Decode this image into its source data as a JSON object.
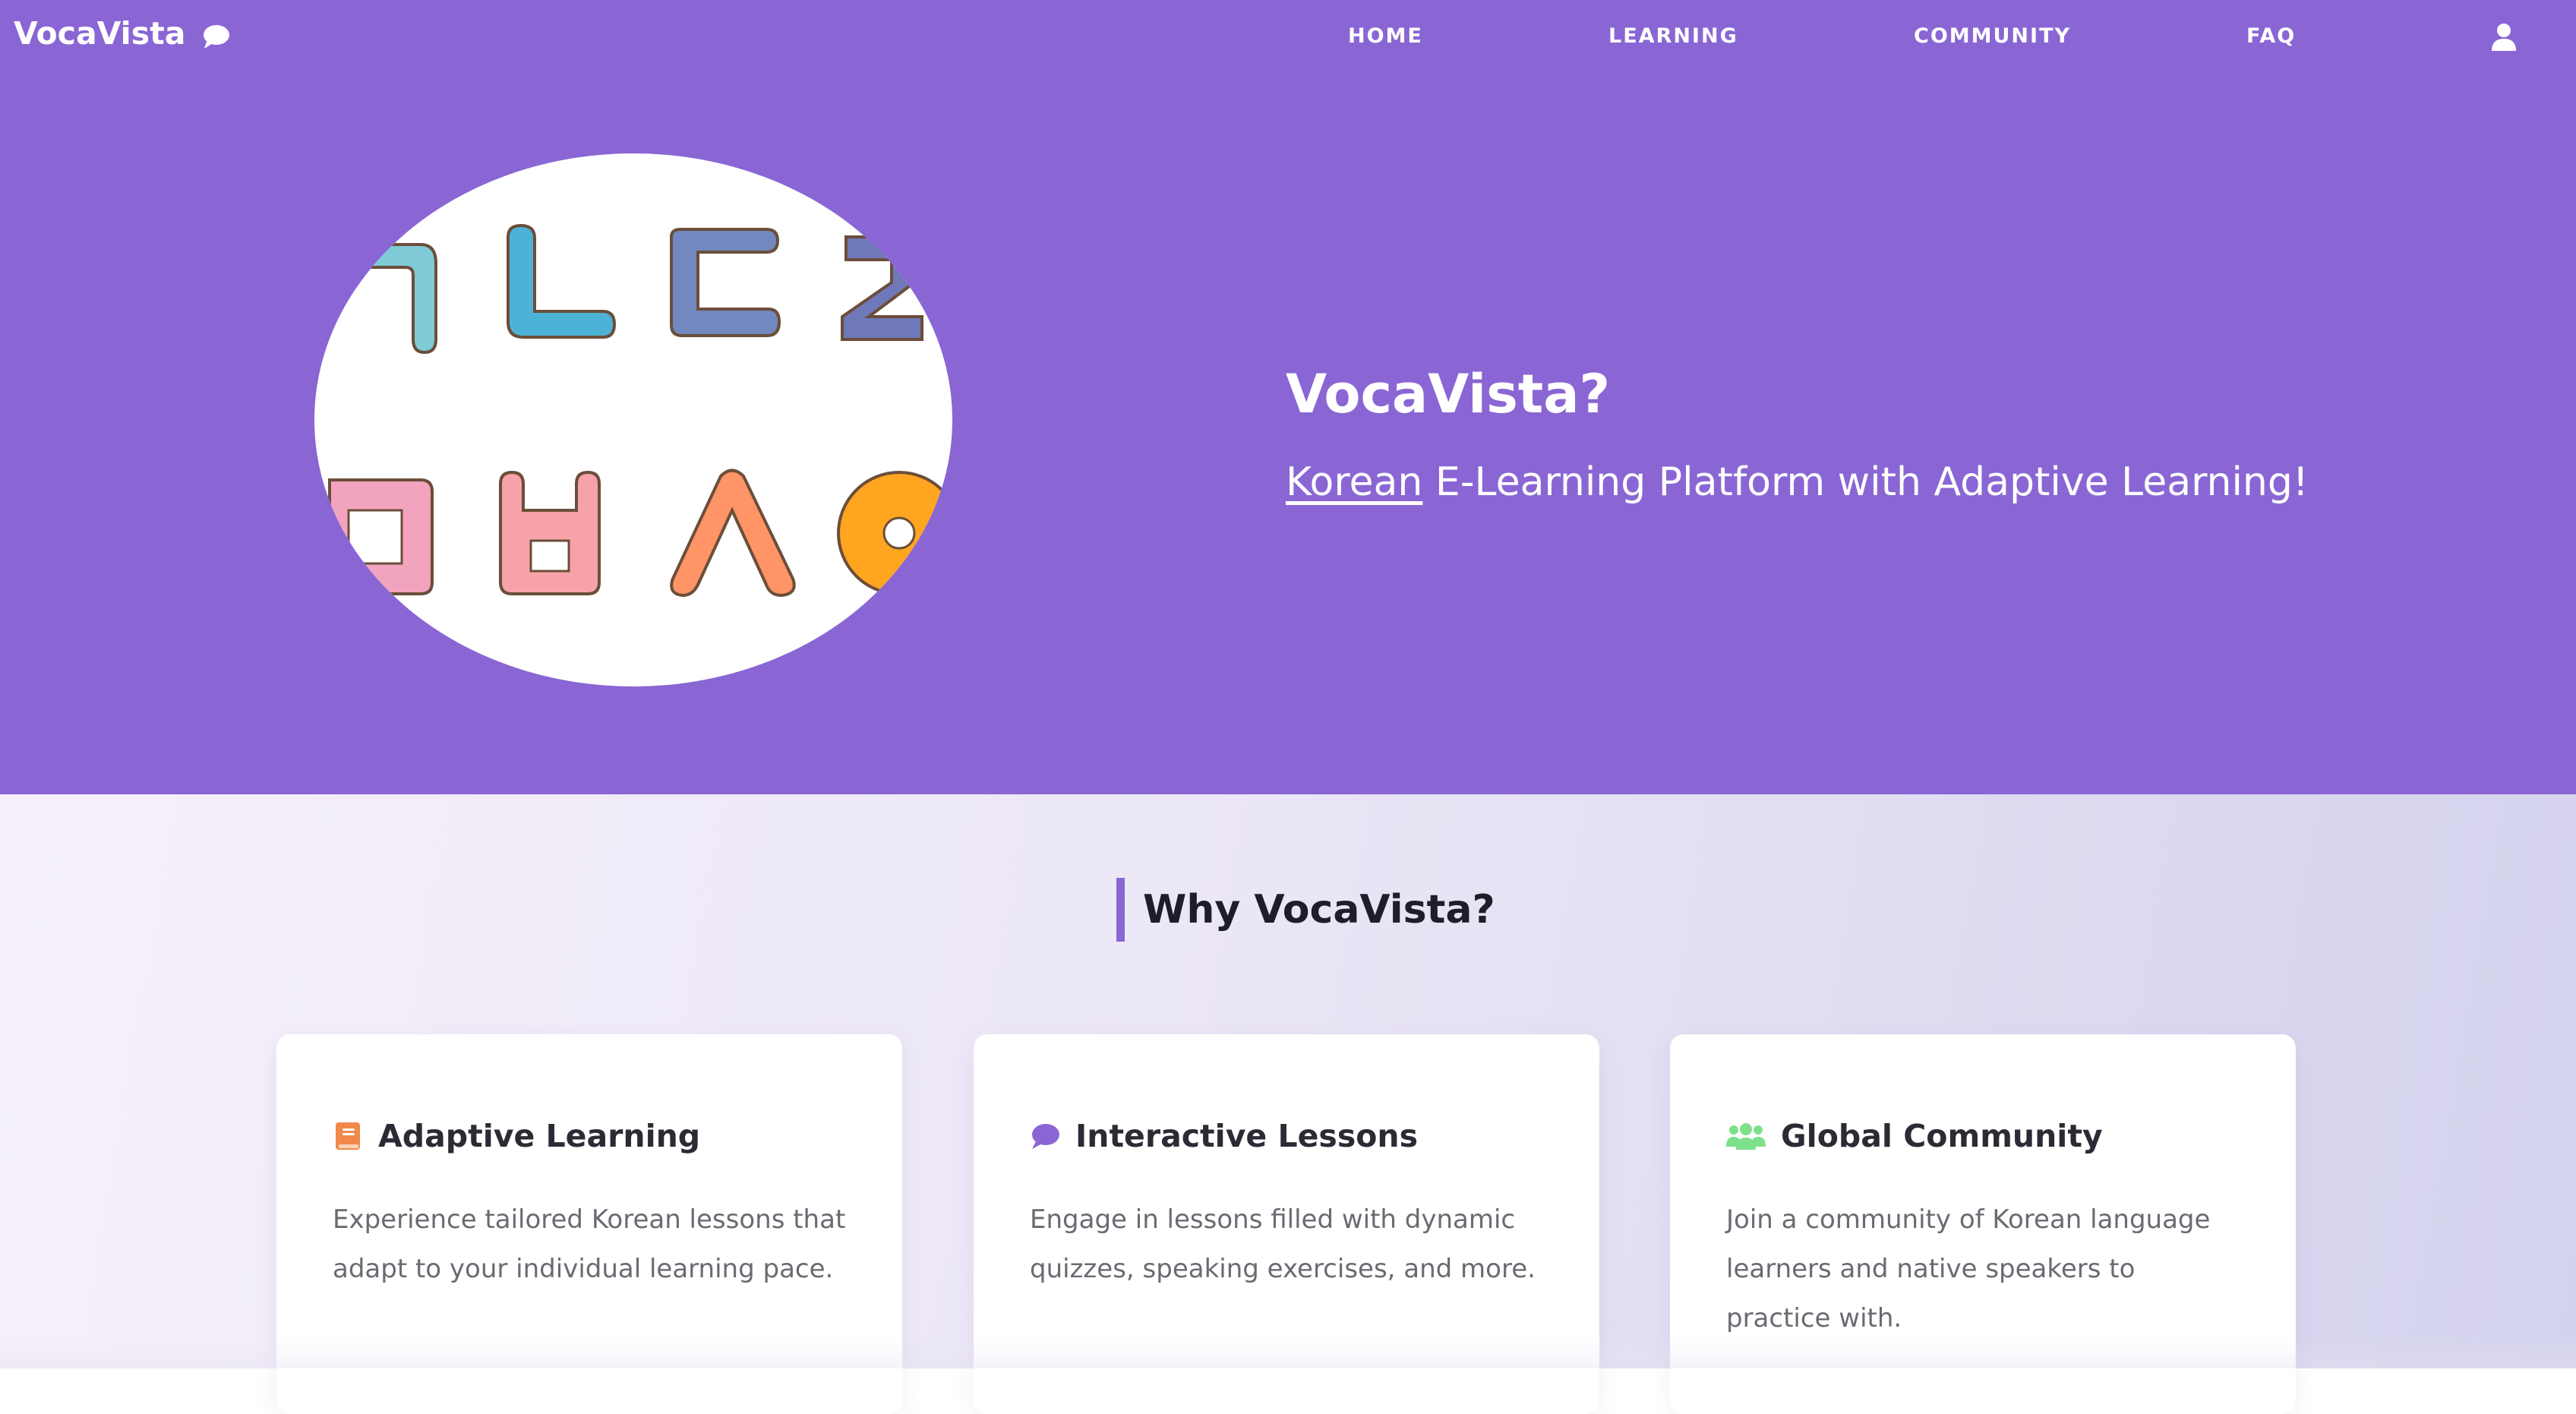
{
  "brand": {
    "name": "VocaVista",
    "icon": "chat-bubble-icon"
  },
  "nav": {
    "items": [
      {
        "label": "HOME"
      },
      {
        "label": "LEARNING"
      },
      {
        "label": "COMMUNITY"
      },
      {
        "label": "FAQ"
      }
    ],
    "user_icon": "user-icon"
  },
  "hero": {
    "title": "VocaVista?",
    "subtitle_highlight": "Korean",
    "subtitle_rest": " E-Learning Platform with Adaptive Learning!",
    "image_icon": "hangul-letters-image"
  },
  "features": {
    "title": "Why VocaVista?",
    "cards": [
      {
        "icon": "book-icon",
        "icon_color": "#f0894a",
        "title": "Adaptive Learning",
        "text": "Experience tailored Korean lessons that adapt to your individual learning pace."
      },
      {
        "icon": "chat-bubble-icon",
        "icon_color": "#8a66d4",
        "title": "Interactive Lessons",
        "text": "Engage in lessons filled with dynamic quizzes, speaking exercises, and more."
      },
      {
        "icon": "users-icon",
        "icon_color": "#7ee08a",
        "title": "Global Community",
        "text": "Join a community of Korean language learners and native speakers to practice with."
      }
    ]
  },
  "colors": {
    "hero_bg": "#8a66d4",
    "accent": "#8a66d4",
    "card_bg": "#ffffff"
  }
}
